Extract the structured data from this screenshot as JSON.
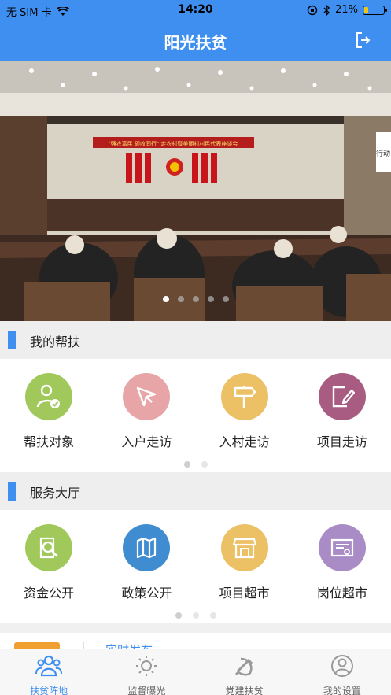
{
  "status_bar": {
    "carrier": "无 SIM 卡",
    "time": "14:20",
    "battery": "21%",
    "battery_level": 0.21
  },
  "header": {
    "title": "阳光扶贫",
    "logout_icon": "logout-icon"
  },
  "banner": {
    "slides": 5,
    "active_slide": 0,
    "photo_banner_text": "\"强农富民  硕收同行\" 走农村暨美丽村村民代表座谈会",
    "sign_text": "行动"
  },
  "my_help": {
    "title": "我的帮扶",
    "items": [
      {
        "label": "帮扶对象",
        "icon": "person-check-icon",
        "color": "#a0c85a"
      },
      {
        "label": "入户走访",
        "icon": "send-arrow-icon",
        "color": "#e7a5a7"
      },
      {
        "label": "入村走访",
        "icon": "signpost-icon",
        "color": "#ecc065"
      },
      {
        "label": "项目走访",
        "icon": "document-edit-icon",
        "color": "#a85c82"
      }
    ],
    "pages": 2,
    "active_page": 0
  },
  "service_hall": {
    "title": "服务大厅",
    "items": [
      {
        "label": "资金公开",
        "icon": "magnifier-document-icon",
        "color": "#a0c85a"
      },
      {
        "label": "政策公开",
        "icon": "map-icon",
        "color": "#3f8dd0"
      },
      {
        "label": "项目超市",
        "icon": "store-icon",
        "color": "#ecc065"
      },
      {
        "label": "岗位超市",
        "icon": "certificate-icon",
        "color": "#a98cc6"
      }
    ],
    "pages": 3,
    "active_page": 0
  },
  "peek": {
    "link_text": "实时发布"
  },
  "tabs": [
    {
      "label": "扶贫阵地",
      "icon": "group-icon",
      "active": true
    },
    {
      "label": "监督曝光",
      "icon": "sun-icon",
      "active": false
    },
    {
      "label": "党建扶贫",
      "icon": "party-emblem-icon",
      "active": false
    },
    {
      "label": "我的设置",
      "icon": "user-circle-icon",
      "active": false
    }
  ],
  "colors": {
    "primary": "#3f8ff0",
    "battery_fill": "#f3c515"
  }
}
